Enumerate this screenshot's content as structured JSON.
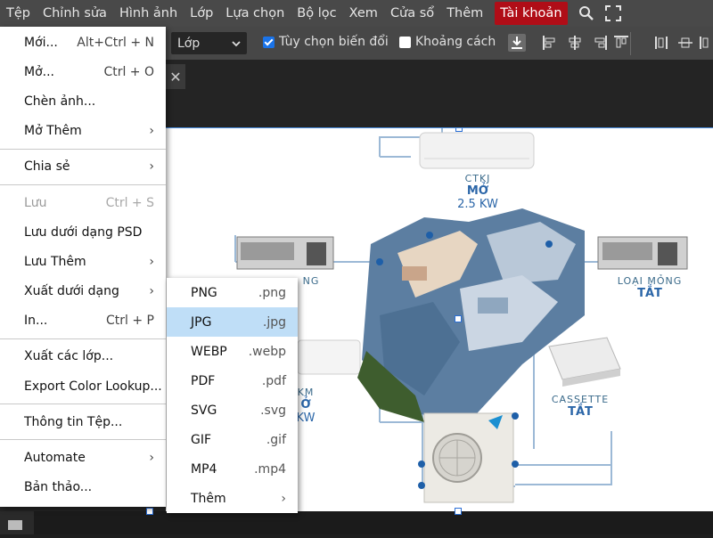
{
  "menubar": {
    "items": [
      "Tệp",
      "Chỉnh sửa",
      "Hình ảnh",
      "Lớp",
      "Lựa chọn",
      "Bộ lọc",
      "Xem",
      "Cửa sổ",
      "Thêm"
    ],
    "account": "Tài khoản",
    "icons": [
      "search-icon",
      "fullscreen-icon"
    ]
  },
  "options": {
    "layer_select": "Lớp",
    "transform_checkbox": {
      "label": "Tùy chọn biến đổi",
      "checked": true
    },
    "spacing_checkbox": {
      "label": "Khoảng cách",
      "checked": false
    }
  },
  "file_menu": {
    "items": [
      {
        "label": "Mới...",
        "shortcut": "Alt+Ctrl + N"
      },
      {
        "label": "Mở...",
        "shortcut": "Ctrl + O"
      },
      {
        "label": "Chèn ảnh..."
      },
      {
        "label": "Mở Thêm",
        "submenu": true
      },
      {
        "label": "Chia sẻ",
        "submenu": true
      },
      {
        "label": "Lưu",
        "shortcut": "Ctrl + S",
        "disabled": true
      },
      {
        "label": "Lưu dưới dạng PSD"
      },
      {
        "label": "Lưu Thêm",
        "submenu": true
      },
      {
        "label": "Xuất dưới dạng",
        "submenu": true
      },
      {
        "label": "In...",
        "shortcut": "Ctrl + P"
      },
      {
        "label": "Xuất các lớp..."
      },
      {
        "label": "Export Color Lookup..."
      },
      {
        "label": "Thông tin Tệp..."
      },
      {
        "label": "Automate",
        "submenu": true
      },
      {
        "label": "Bản thảo..."
      }
    ]
  },
  "export_menu": {
    "items": [
      {
        "label": "PNG",
        "ext": ".png"
      },
      {
        "label": "JPG",
        "ext": ".jpg",
        "highlighted": true
      },
      {
        "label": "WEBP",
        "ext": ".webp"
      },
      {
        "label": "PDF",
        "ext": ".pdf"
      },
      {
        "label": "SVG",
        "ext": ".svg"
      },
      {
        "label": "GIF",
        "ext": ".gif"
      },
      {
        "label": "MP4",
        "ext": ".mp4"
      },
      {
        "label": "Thêm",
        "submenu": true
      }
    ]
  },
  "canvas_image": {
    "ctkj": {
      "line1": "CTKJ",
      "line2": "MỞ",
      "line3": "2.5 KW"
    },
    "loai_mong": {
      "line1": "LOẠI MỎNG",
      "line2": "TẮT"
    },
    "left_duct": {
      "line1": "NG"
    },
    "left_wall": {
      "line1": "KM",
      "line2": "Ở",
      "line3": "KW"
    },
    "cassette": {
      "line1": "CASSETTE",
      "line2": "TẮT"
    }
  },
  "colors": {
    "menubar_bg": "#494949",
    "account_bg": "#b00d17",
    "highlight": "#bfdef7",
    "checkbox_on": "#1a73e8"
  }
}
